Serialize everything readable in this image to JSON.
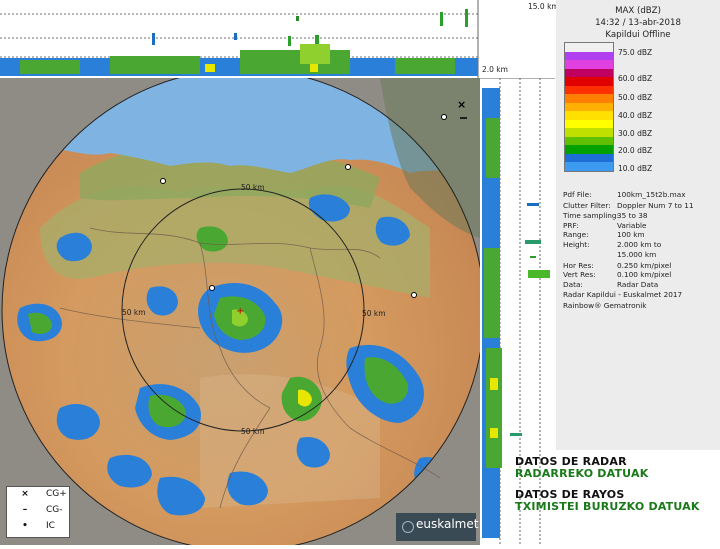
{
  "top_axis": {
    "label": "15.0 km"
  },
  "right_axis": {
    "label": "2.0 km"
  },
  "header": {
    "product": "MAX (dBZ)",
    "datetime": "14:32 / 13-abr-2018",
    "station": "Kapildui Offline"
  },
  "colorbar": {
    "labels": [
      "75.0 dBZ",
      "60.0 dBZ",
      "50.0 dBZ",
      "40.0 dBZ",
      "30.0 dBZ",
      "20.0 dBZ",
      "10.0 dBZ"
    ],
    "colors": [
      "#f0f0f0",
      "#b040f0",
      "#e040e0",
      "#c00060",
      "#e00000",
      "#ff3000",
      "#ff8000",
      "#ffb000",
      "#ffe000",
      "#ffff00",
      "#c0e000",
      "#60c000",
      "#00a000",
      "#1e6ed8",
      "#3c9bf0"
    ]
  },
  "metadata": [
    {
      "key": "Pdf File:",
      "value": "100km_15t2b.max"
    },
    {
      "key": "Clutter Filter:",
      "value": "Doppler Num 7 to 11"
    },
    {
      "key": "Time sampling:",
      "value": "35 to 38"
    },
    {
      "key": "PRF:",
      "value": "Variable"
    },
    {
      "key": "Range:",
      "value": "100 km"
    },
    {
      "key": "Height:",
      "value": "2.000 km to"
    },
    {
      "key": "",
      "value": "15.000 km"
    },
    {
      "key": "Hor Res:",
      "value": "0.250 km/pixel"
    },
    {
      "key": "Vert Res:",
      "value": "0.100 km/pixel"
    },
    {
      "key": "Data:",
      "value": "Radar Data"
    }
  ],
  "credits": [
    "Radar Kapildui - Euskalmet 2017",
    "Rainbow® Gematronik"
  ],
  "map": {
    "ring_labels": [
      "50 km",
      "50 km",
      "50 km",
      "50 km"
    ]
  },
  "links": {
    "radar_es": "DATOS DE RADAR",
    "radar_eu": "RADARREKO DATUAK",
    "rayos_es": "DATOS DE RAYOS",
    "rayos_eu": "TXIMISTEI BURUZKO DATUAK"
  },
  "lightning_legend": [
    {
      "symbol": "×",
      "label": "CG+"
    },
    {
      "symbol": "–",
      "label": "CG-"
    },
    {
      "symbol": "•",
      "label": "IC"
    }
  ],
  "logo": {
    "text": "euskalmet"
  }
}
